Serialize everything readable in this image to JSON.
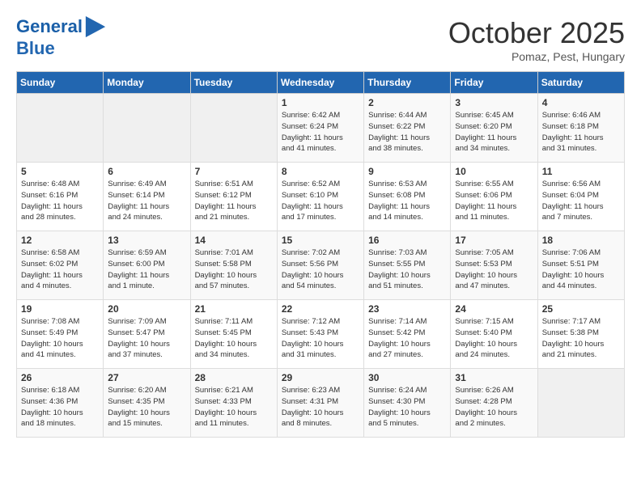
{
  "header": {
    "logo_line1": "General",
    "logo_line2": "Blue",
    "month": "October 2025",
    "location": "Pomaz, Pest, Hungary"
  },
  "days_of_week": [
    "Sunday",
    "Monday",
    "Tuesday",
    "Wednesday",
    "Thursday",
    "Friday",
    "Saturday"
  ],
  "weeks": [
    [
      {
        "day": "",
        "info": ""
      },
      {
        "day": "",
        "info": ""
      },
      {
        "day": "",
        "info": ""
      },
      {
        "day": "1",
        "info": "Sunrise: 6:42 AM\nSunset: 6:24 PM\nDaylight: 11 hours\nand 41 minutes."
      },
      {
        "day": "2",
        "info": "Sunrise: 6:44 AM\nSunset: 6:22 PM\nDaylight: 11 hours\nand 38 minutes."
      },
      {
        "day": "3",
        "info": "Sunrise: 6:45 AM\nSunset: 6:20 PM\nDaylight: 11 hours\nand 34 minutes."
      },
      {
        "day": "4",
        "info": "Sunrise: 6:46 AM\nSunset: 6:18 PM\nDaylight: 11 hours\nand 31 minutes."
      }
    ],
    [
      {
        "day": "5",
        "info": "Sunrise: 6:48 AM\nSunset: 6:16 PM\nDaylight: 11 hours\nand 28 minutes."
      },
      {
        "day": "6",
        "info": "Sunrise: 6:49 AM\nSunset: 6:14 PM\nDaylight: 11 hours\nand 24 minutes."
      },
      {
        "day": "7",
        "info": "Sunrise: 6:51 AM\nSunset: 6:12 PM\nDaylight: 11 hours\nand 21 minutes."
      },
      {
        "day": "8",
        "info": "Sunrise: 6:52 AM\nSunset: 6:10 PM\nDaylight: 11 hours\nand 17 minutes."
      },
      {
        "day": "9",
        "info": "Sunrise: 6:53 AM\nSunset: 6:08 PM\nDaylight: 11 hours\nand 14 minutes."
      },
      {
        "day": "10",
        "info": "Sunrise: 6:55 AM\nSunset: 6:06 PM\nDaylight: 11 hours\nand 11 minutes."
      },
      {
        "day": "11",
        "info": "Sunrise: 6:56 AM\nSunset: 6:04 PM\nDaylight: 11 hours\nand 7 minutes."
      }
    ],
    [
      {
        "day": "12",
        "info": "Sunrise: 6:58 AM\nSunset: 6:02 PM\nDaylight: 11 hours\nand 4 minutes."
      },
      {
        "day": "13",
        "info": "Sunrise: 6:59 AM\nSunset: 6:00 PM\nDaylight: 11 hours\nand 1 minute."
      },
      {
        "day": "14",
        "info": "Sunrise: 7:01 AM\nSunset: 5:58 PM\nDaylight: 10 hours\nand 57 minutes."
      },
      {
        "day": "15",
        "info": "Sunrise: 7:02 AM\nSunset: 5:56 PM\nDaylight: 10 hours\nand 54 minutes."
      },
      {
        "day": "16",
        "info": "Sunrise: 7:03 AM\nSunset: 5:55 PM\nDaylight: 10 hours\nand 51 minutes."
      },
      {
        "day": "17",
        "info": "Sunrise: 7:05 AM\nSunset: 5:53 PM\nDaylight: 10 hours\nand 47 minutes."
      },
      {
        "day": "18",
        "info": "Sunrise: 7:06 AM\nSunset: 5:51 PM\nDaylight: 10 hours\nand 44 minutes."
      }
    ],
    [
      {
        "day": "19",
        "info": "Sunrise: 7:08 AM\nSunset: 5:49 PM\nDaylight: 10 hours\nand 41 minutes."
      },
      {
        "day": "20",
        "info": "Sunrise: 7:09 AM\nSunset: 5:47 PM\nDaylight: 10 hours\nand 37 minutes."
      },
      {
        "day": "21",
        "info": "Sunrise: 7:11 AM\nSunset: 5:45 PM\nDaylight: 10 hours\nand 34 minutes."
      },
      {
        "day": "22",
        "info": "Sunrise: 7:12 AM\nSunset: 5:43 PM\nDaylight: 10 hours\nand 31 minutes."
      },
      {
        "day": "23",
        "info": "Sunrise: 7:14 AM\nSunset: 5:42 PM\nDaylight: 10 hours\nand 27 minutes."
      },
      {
        "day": "24",
        "info": "Sunrise: 7:15 AM\nSunset: 5:40 PM\nDaylight: 10 hours\nand 24 minutes."
      },
      {
        "day": "25",
        "info": "Sunrise: 7:17 AM\nSunset: 5:38 PM\nDaylight: 10 hours\nand 21 minutes."
      }
    ],
    [
      {
        "day": "26",
        "info": "Sunrise: 6:18 AM\nSunset: 4:36 PM\nDaylight: 10 hours\nand 18 minutes."
      },
      {
        "day": "27",
        "info": "Sunrise: 6:20 AM\nSunset: 4:35 PM\nDaylight: 10 hours\nand 15 minutes."
      },
      {
        "day": "28",
        "info": "Sunrise: 6:21 AM\nSunset: 4:33 PM\nDaylight: 10 hours\nand 11 minutes."
      },
      {
        "day": "29",
        "info": "Sunrise: 6:23 AM\nSunset: 4:31 PM\nDaylight: 10 hours\nand 8 minutes."
      },
      {
        "day": "30",
        "info": "Sunrise: 6:24 AM\nSunset: 4:30 PM\nDaylight: 10 hours\nand 5 minutes."
      },
      {
        "day": "31",
        "info": "Sunrise: 6:26 AM\nSunset: 4:28 PM\nDaylight: 10 hours\nand 2 minutes."
      },
      {
        "day": "",
        "info": ""
      }
    ]
  ]
}
